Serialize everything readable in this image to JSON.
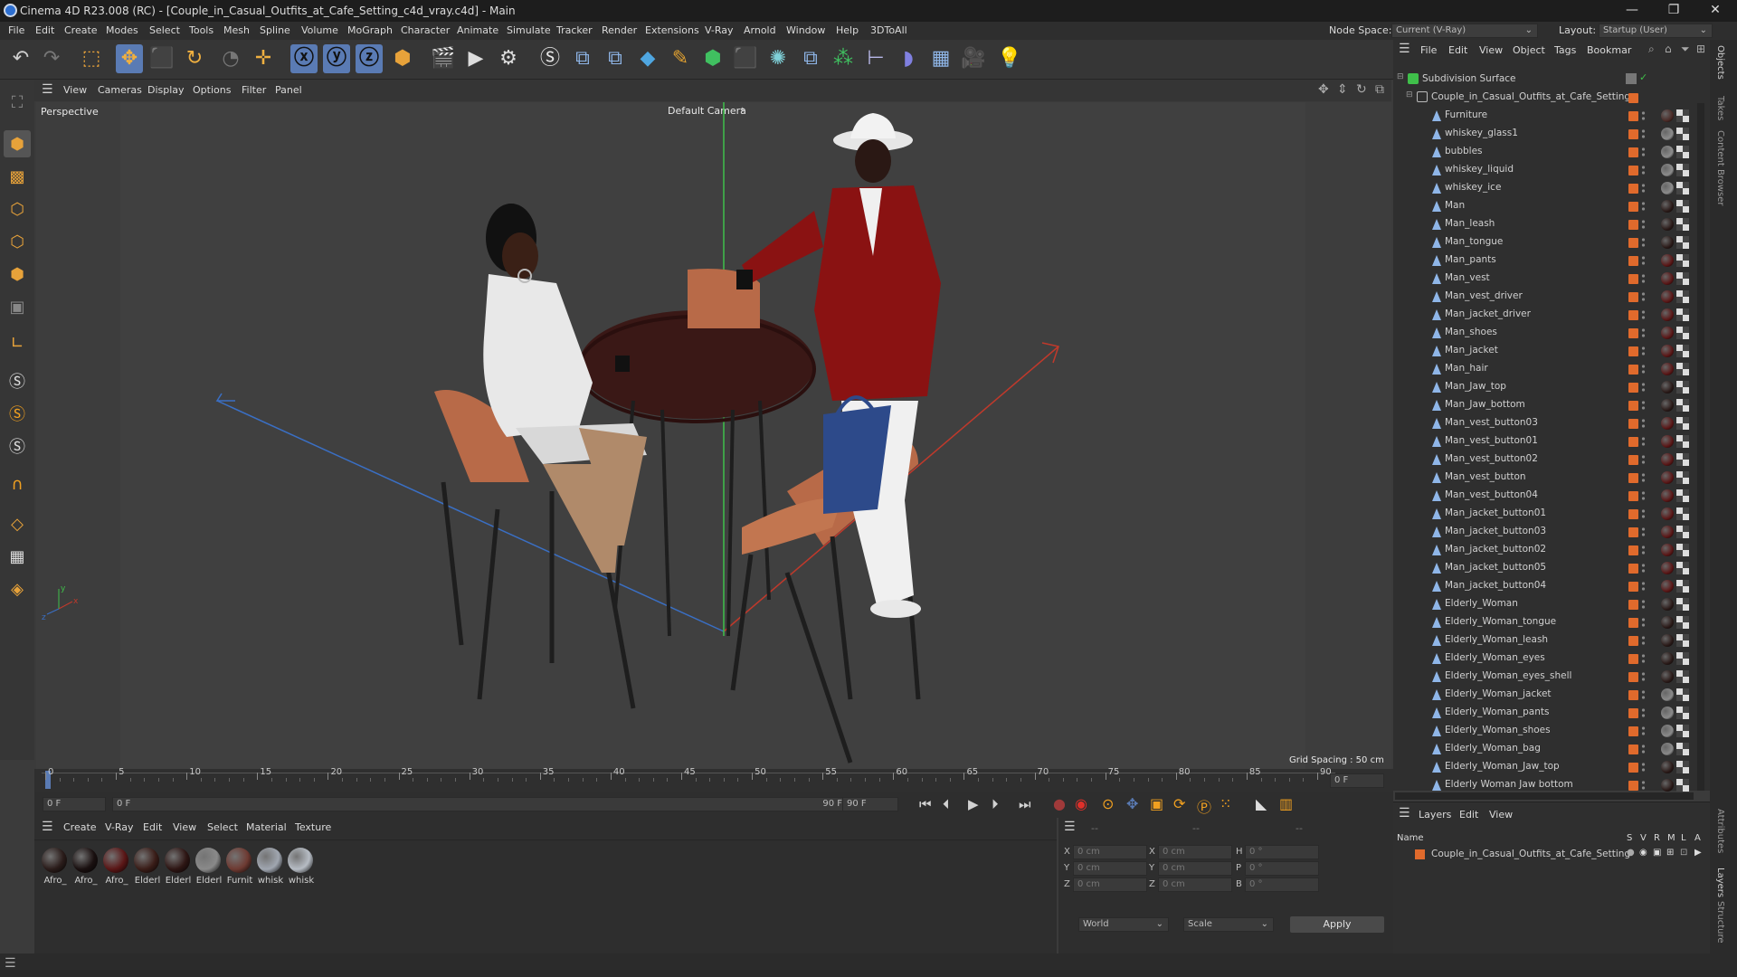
{
  "window": {
    "title": "Cinema 4D R23.008 (RC) - [Couple_in_Casual_Outfits_at_Cafe_Setting_c4d_vray.c4d] - Main",
    "controls": [
      "—",
      "❐",
      "✕"
    ]
  },
  "menu": [
    "File",
    "Edit",
    "Create",
    "Modes",
    "Select",
    "Tools",
    "Mesh",
    "Spline",
    "Volume",
    "MoGraph",
    "Character",
    "Animate",
    "Simulate",
    "Tracker",
    "Render",
    "Extensions",
    "V-Ray",
    "Arnold",
    "Window",
    "Help",
    "3DToAll"
  ],
  "node_space": {
    "label": "Node Space:",
    "value": "Current (V-Ray)"
  },
  "layout": {
    "label": "Layout:",
    "value": "Startup (User)"
  },
  "viewport": {
    "menu": [
      "View",
      "Cameras",
      "Display",
      "Options",
      "Filter",
      "Panel"
    ],
    "name": "Perspective",
    "camera": "Default Camera",
    "grid_spacing": "Grid Spacing : 50 cm"
  },
  "timeline": {
    "ticks": [
      "0",
      "5",
      "10",
      "15",
      "20",
      "25",
      "30",
      "35",
      "40",
      "45",
      "50",
      "55",
      "60",
      "65",
      "70",
      "75",
      "80",
      "85",
      "90"
    ],
    "end_field": "0 F"
  },
  "transport": {
    "current_frame": "0 F",
    "range_start": "0 F",
    "range_end": "90 F",
    "max_frame": "90 F"
  },
  "materials": {
    "menu": [
      "Create",
      "V-Ray",
      "Edit",
      "View",
      "Select",
      "Material",
      "Texture"
    ],
    "items": [
      {
        "label": "Afro_",
        "color": "#2a1c1a"
      },
      {
        "label": "Afro_",
        "color": "#1a1010"
      },
      {
        "label": "Afro_",
        "color": "#5a1616"
      },
      {
        "label": "Elderl",
        "color": "#3a1d18"
      },
      {
        "label": "Elderl",
        "color": "#2e1614"
      },
      {
        "label": "Elderl",
        "color": "#8a8a8a"
      },
      {
        "label": "Furnit",
        "color": "#6e3a32"
      },
      {
        "label": "whisk",
        "color": "#a0a6b0"
      },
      {
        "label": "whisk",
        "color": "#b6bcc4"
      }
    ]
  },
  "coordinates": {
    "rows": [
      {
        "a": "X",
        "av": "0 cm",
        "b": "X",
        "bv": "0 cm",
        "c": "H",
        "cv": "0 °"
      },
      {
        "a": "Y",
        "av": "0 cm",
        "b": "Y",
        "bv": "0 cm",
        "c": "P",
        "cv": "0 °"
      },
      {
        "a": "Z",
        "av": "0 cm",
        "b": "Z",
        "bv": "0 cm",
        "c": "B",
        "cv": "0 °"
      }
    ],
    "mode": "World",
    "transform": "Scale",
    "apply": "Apply",
    "dashes": [
      "--",
      "--",
      "--"
    ]
  },
  "objects": {
    "menu": [
      "File",
      "Edit",
      "View",
      "Object",
      "Tags",
      "Bookmar"
    ],
    "root": "Subdivision Surface",
    "group": "Couple_in_Casual_Outfits_at_Cafe_Setting",
    "items": [
      {
        "name": "Furniture",
        "mat": "#4a2a26"
      },
      {
        "name": "whiskey_glass1",
        "mat": "#8c8c8c"
      },
      {
        "name": "bubbles",
        "mat": "#8c8c8c"
      },
      {
        "name": "whiskey_liquid",
        "mat": "#8c8c8c"
      },
      {
        "name": "whiskey_ice",
        "mat": "#8c8c8c"
      },
      {
        "name": "Man",
        "mat": "#2a1a18"
      },
      {
        "name": "Man_leash",
        "mat": "#2a1a18"
      },
      {
        "name": "Man_tongue",
        "mat": "#2a1a18"
      },
      {
        "name": "Man_pants",
        "mat": "#5a1616"
      },
      {
        "name": "Man_vest",
        "mat": "#5a1616"
      },
      {
        "name": "Man_vest_driver",
        "mat": "#5a1616"
      },
      {
        "name": "Man_jacket_driver",
        "mat": "#5a1616"
      },
      {
        "name": "Man_shoes",
        "mat": "#5a1616"
      },
      {
        "name": "Man_jacket",
        "mat": "#5a1616"
      },
      {
        "name": "Man_hair",
        "mat": "#5a1616"
      },
      {
        "name": "Man_Jaw_top",
        "mat": "#2a1a18"
      },
      {
        "name": "Man_Jaw_bottom",
        "mat": "#2a1a18"
      },
      {
        "name": "Man_vest_button03",
        "mat": "#5a1616"
      },
      {
        "name": "Man_vest_button01",
        "mat": "#5a1616"
      },
      {
        "name": "Man_vest_button02",
        "mat": "#5a1616"
      },
      {
        "name": "Man_vest_button",
        "mat": "#5a1616"
      },
      {
        "name": "Man_vest_button04",
        "mat": "#5a1616"
      },
      {
        "name": "Man_jacket_button01",
        "mat": "#5a1616"
      },
      {
        "name": "Man_jacket_button03",
        "mat": "#5a1616"
      },
      {
        "name": "Man_jacket_button02",
        "mat": "#5a1616"
      },
      {
        "name": "Man_jacket_button05",
        "mat": "#5a1616"
      },
      {
        "name": "Man_jacket_button04",
        "mat": "#5a1616"
      },
      {
        "name": "Elderly_Woman",
        "mat": "#2a1a18"
      },
      {
        "name": "Elderly_Woman_tongue",
        "mat": "#2a1a18"
      },
      {
        "name": "Elderly_Woman_leash",
        "mat": "#2a1a18"
      },
      {
        "name": "Elderly_Woman_eyes",
        "mat": "#2a1a18"
      },
      {
        "name": "Elderly_Woman_eyes_shell",
        "mat": "#2a1a18"
      },
      {
        "name": "Elderly_Woman_jacket",
        "mat": "#8a8a8a"
      },
      {
        "name": "Elderly_Woman_pants",
        "mat": "#8a8a8a"
      },
      {
        "name": "Elderly_Woman_shoes",
        "mat": "#8a8a8a"
      },
      {
        "name": "Elderly_Woman_bag",
        "mat": "#8a8a8a"
      },
      {
        "name": "Elderly_Woman_Jaw_top",
        "mat": "#2a1a18"
      },
      {
        "name": "Elderly Woman Jaw bottom",
        "mat": "#2a1a18"
      }
    ]
  },
  "layers": {
    "menu": [
      "Layers",
      "Edit",
      "View"
    ],
    "header_name": "Name",
    "flags": [
      "S",
      "V",
      "R",
      "M",
      "L",
      "A"
    ],
    "item": "Couple_in_Casual_Outfits_at_Cafe_Setting"
  },
  "side_tabs": [
    "Objects",
    "Takes",
    "Content Browser",
    "Attributes",
    "Layers",
    "Structure"
  ],
  "colors": {
    "accent": "#5a7bb4",
    "tag_orange": "#e06a2c",
    "axis_x": "#c0392b",
    "axis_y": "#3fbf4a",
    "axis_z": "#3a6fc4"
  }
}
